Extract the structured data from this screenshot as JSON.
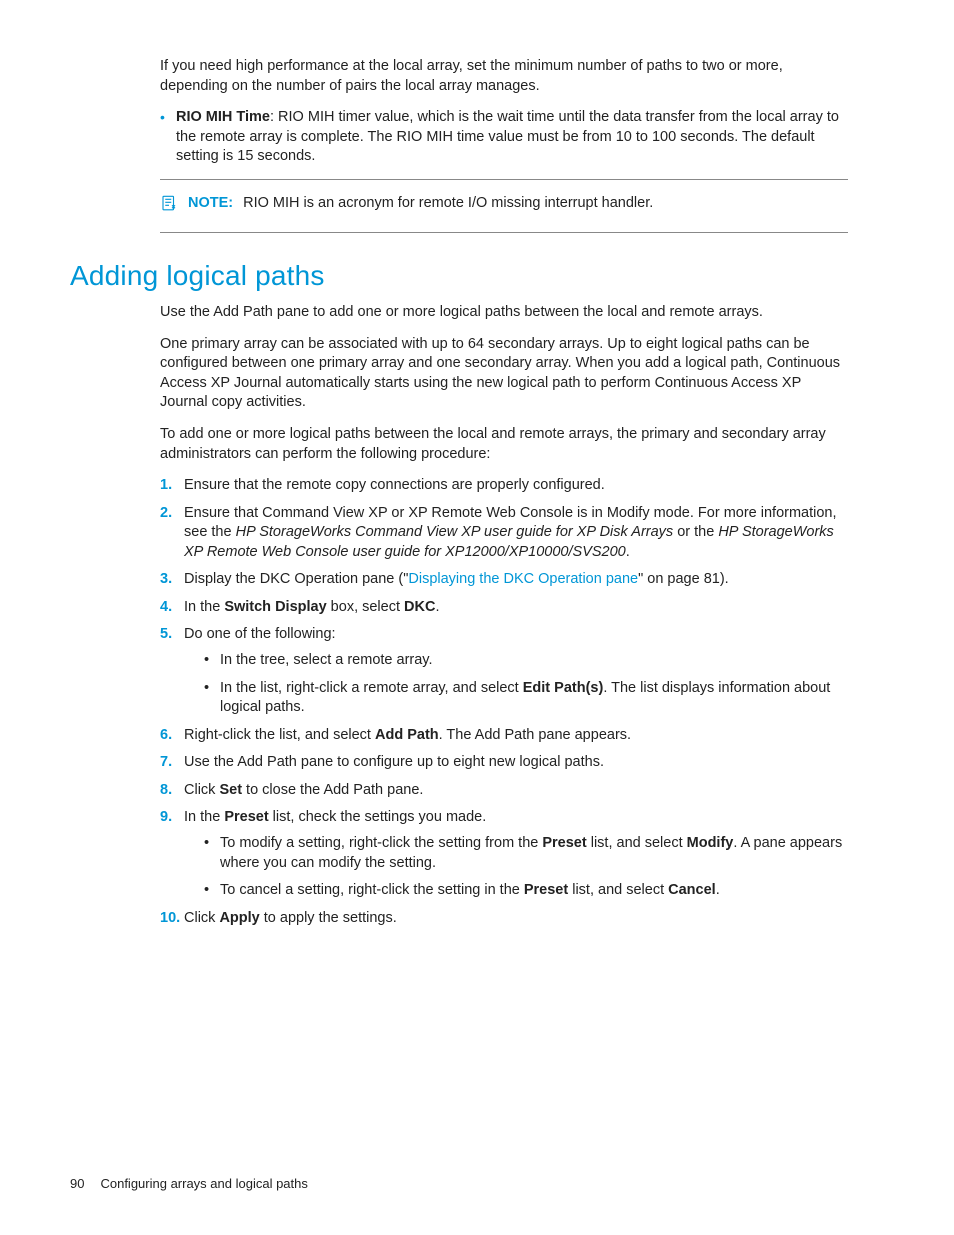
{
  "intro": {
    "p1": "If you need high performance at the local array, set the minimum number of paths to two or more, depending on the number of pairs the local array manages.",
    "bullet_label": "RIO MIH Time",
    "bullet_rest": ": RIO MIH timer value, which is the wait time until the data transfer from the local array to the remote array is complete. The RIO MIH time value must be from 10 to 100 seconds. The default setting is 15 seconds."
  },
  "note": {
    "label": "NOTE:",
    "text": "RIO MIH is an acronym for remote I/O missing interrupt handler."
  },
  "section_title": "Adding logical paths",
  "body": {
    "p1": "Use the Add Path pane to add one or more logical paths between the local and remote arrays.",
    "p2": "One primary array can be associated with up to 64 secondary arrays. Up to eight logical paths can be configured between one primary array and one secondary array. When you add a logical path, Continuous Access XP Journal automatically starts using the new logical path to perform Continuous Access XP Journal copy activities.",
    "p3": "To add one or more logical paths between the local and remote arrays, the primary and secondary array administrators can perform the following procedure:"
  },
  "steps": {
    "s1": "Ensure that the remote copy connections are properly configured.",
    "s2a": "Ensure that Command View XP or XP Remote Web Console is in Modify mode. For more information, see the ",
    "s2i1": "HP StorageWorks Command View XP user guide for XP Disk Arrays",
    "s2mid": " or the ",
    "s2i2": "HP StorageWorks XP Remote Web Console user guide for XP12000/XP10000/SVS200",
    "s2end": ".",
    "s3a": "Display the DKC Operation pane (\"",
    "s3link": "Displaying the DKC Operation pane",
    "s3b": "\" on page 81).",
    "s4a": "In the ",
    "s4b1": "Switch Display",
    "s4mid": " box, select ",
    "s4b2": "DKC",
    "s4end": ".",
    "s5": "Do one of the following:",
    "s5sub1": "In the tree, select a remote array.",
    "s5sub2a": "In the list, right-click a remote array, and select ",
    "s5sub2b": "Edit Path(s)",
    "s5sub2c": ". The list displays information about logical paths.",
    "s6a": "Right-click the list, and select ",
    "s6b": "Add Path",
    "s6c": ". The Add Path pane appears.",
    "s7": "Use the Add Path pane to configure up to eight new logical paths.",
    "s8a": "Click ",
    "s8b": "Set",
    "s8c": " to close the Add Path pane.",
    "s9a": "In the ",
    "s9b": "Preset",
    "s9c": " list, check the settings you made.",
    "s9sub1a": "To modify a setting, right-click the setting from the ",
    "s9sub1b": "Preset",
    "s9sub1c": " list, and select ",
    "s9sub1d": "Modify",
    "s9sub1e": ". A pane appears where you can modify the setting.",
    "s9sub2a": "To cancel a setting, right-click the setting in the ",
    "s9sub2b": "Preset",
    "s9sub2c": " list, and select ",
    "s9sub2d": "Cancel",
    "s9sub2e": ".",
    "s10a": "Click ",
    "s10b": "Apply",
    "s10c": " to apply the settings."
  },
  "footer": {
    "page": "90",
    "title": "Configuring arrays and logical paths"
  }
}
